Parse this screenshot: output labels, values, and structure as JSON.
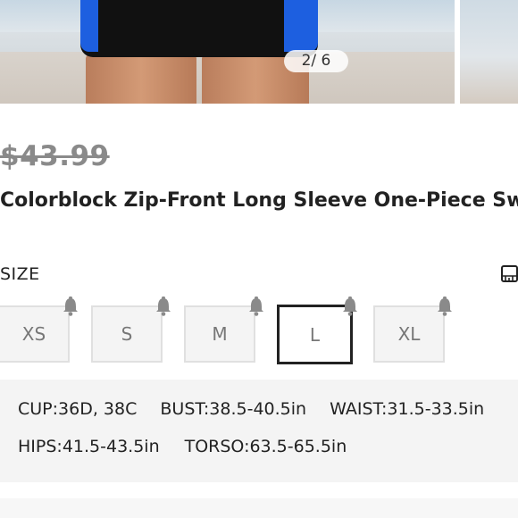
{
  "carousel": {
    "counter": "2/ 6",
    "colors": {
      "panel": "#1d5fe0",
      "fabric": "#111111"
    }
  },
  "product": {
    "price": "$43.99",
    "title": "Colorblock Zip-Front Long Sleeve One-Piece Swimsuit"
  },
  "size": {
    "label": "SIZE",
    "guide_icon": "size-guide-ruler-icon",
    "options": [
      "XS",
      "S",
      "M",
      "L",
      "XL"
    ],
    "selected": "L",
    "notify_icon": "bell-icon"
  },
  "measurements": {
    "cup": {
      "label": "CUP",
      "value": ":36D, 38C"
    },
    "bust": {
      "label": "BUST",
      "value": ":38.5-40.5in"
    },
    "waist": {
      "label": "WAIST",
      "value": ":31.5-33.5in"
    },
    "hips": {
      "label": "HIPS",
      "value": ":41.5-43.5in"
    },
    "torso": {
      "label": "TORSO",
      "value": ":63.5-65.5in"
    }
  }
}
